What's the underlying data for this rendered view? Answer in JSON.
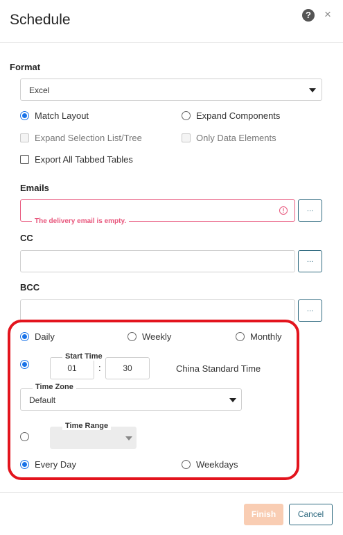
{
  "dialog": {
    "title": "Schedule",
    "help_icon": "question-circle-icon",
    "close_icon": "close-icon",
    "help_glyph": "?",
    "close_glyph": "×"
  },
  "format": {
    "label": "Format",
    "selected": "Excel",
    "options": [
      {
        "label": "Match Layout",
        "type": "radio",
        "checked": true
      },
      {
        "label": "Expand Components",
        "type": "radio",
        "checked": false
      },
      {
        "label": "Expand Selection List/Tree",
        "type": "checkbox",
        "checked": false,
        "disabled": true
      },
      {
        "label": "Only Data Elements",
        "type": "checkbox",
        "checked": false,
        "disabled": true
      },
      {
        "label": "Export All Tabbed Tables",
        "type": "checkbox",
        "checked": false
      }
    ]
  },
  "emails": {
    "label": "Emails",
    "value": "",
    "error": "The delivery email is empty.",
    "button": "..."
  },
  "cc": {
    "label": "CC",
    "value": "",
    "button": "..."
  },
  "bcc": {
    "label": "BCC",
    "value": "",
    "button": "..."
  },
  "schedule": {
    "frequency": [
      {
        "label": "Daily",
        "checked": true
      },
      {
        "label": "Weekly",
        "checked": false
      },
      {
        "label": "Monthly",
        "checked": false
      }
    ],
    "start_time": {
      "label": "Start Time",
      "hour": "01",
      "separator": ":",
      "minute": "30",
      "timezone_text": "China Standard Time"
    },
    "time_zone": {
      "label": "Time Zone",
      "selected": "Default"
    },
    "time_range": {
      "label": "Time Range",
      "selected": ""
    },
    "day_options": [
      {
        "label": "Every Day",
        "checked": true
      },
      {
        "label": "Weekdays",
        "checked": false
      }
    ]
  },
  "footer": {
    "finish": "Finish",
    "cancel": "Cancel"
  },
  "colors": {
    "accent": "#1a73e8",
    "error": "#e8567c",
    "highlight": "#e3141d",
    "button_border": "#2f6a80",
    "finish_disabled": "#f9cdb3"
  }
}
